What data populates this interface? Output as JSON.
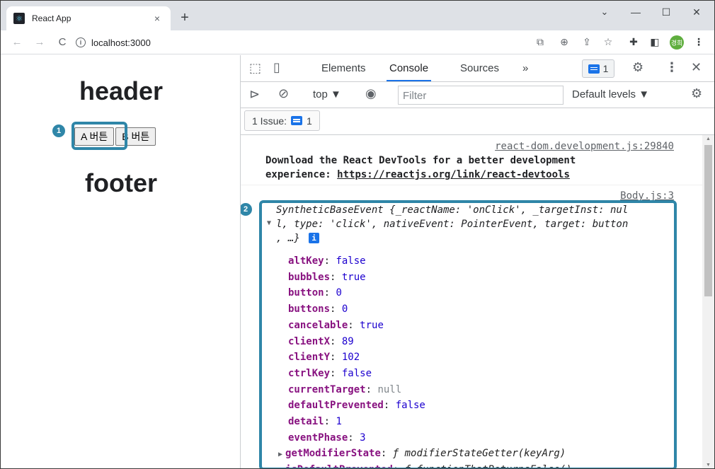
{
  "browser": {
    "tab_title": "React App",
    "tab_close": "×",
    "new_tab": "+",
    "url": "localhost:3000",
    "window_controls": {
      "minimize": "—",
      "maximize": "☐",
      "close": "✕",
      "dropdown": "⌄"
    },
    "nav": {
      "back": "←",
      "forward": "→",
      "reload": "C"
    },
    "profile_label": "경희"
  },
  "page": {
    "header": "header",
    "buttons": [
      "A 버튼",
      "B 버튼"
    ],
    "footer": "footer",
    "markers": [
      "1",
      "2"
    ]
  },
  "devtools": {
    "tabs": [
      "Elements",
      "Console",
      "Sources"
    ],
    "active_tab": "Console",
    "more_tabs": "»",
    "message_count": "1",
    "context": "top ▼",
    "filter_placeholder": "Filter",
    "levels": "Default levels ▼",
    "issues_label": "1 Issue:",
    "issues_count": "1",
    "accent": "#1a73e8"
  },
  "console": {
    "msg1_source": "react-dom.development.js:29840",
    "msg1_line1": "Download the React DevTools for a better development",
    "msg1_line2_prefix": "experience: ",
    "msg1_link": "https://reactjs.org/link/react-devtools",
    "msg2_source": "Body.js:3",
    "msg2_header": {
      "line1": "SyntheticBaseEvent {_reactName: 'onClick', _targetInst: nul",
      "line2": "l, type: 'click', nativeEvent: PointerEvent, target: button",
      "line3": ", …}"
    },
    "properties": [
      {
        "key": "altKey",
        "value": "false",
        "type": "bool"
      },
      {
        "key": "bubbles",
        "value": "true",
        "type": "bool"
      },
      {
        "key": "button",
        "value": "0",
        "type": "num"
      },
      {
        "key": "buttons",
        "value": "0",
        "type": "num"
      },
      {
        "key": "cancelable",
        "value": "true",
        "type": "bool"
      },
      {
        "key": "clientX",
        "value": "89",
        "type": "num"
      },
      {
        "key": "clientY",
        "value": "102",
        "type": "num"
      },
      {
        "key": "ctrlKey",
        "value": "false",
        "type": "bool"
      },
      {
        "key": "currentTarget",
        "value": "null",
        "type": "null"
      },
      {
        "key": "defaultPrevented",
        "value": "false",
        "type": "bool"
      },
      {
        "key": "detail",
        "value": "1",
        "type": "num"
      },
      {
        "key": "eventPhase",
        "value": "3",
        "type": "num"
      },
      {
        "key": "getModifierState",
        "value": "ƒ modifierStateGetter(keyArg)",
        "type": "fn"
      },
      {
        "key": "isDefaultPrevented",
        "value": "ƒ functionThatReturnsFalse()",
        "type": "fn"
      }
    ],
    "highlight_color": "#2f86a8"
  }
}
